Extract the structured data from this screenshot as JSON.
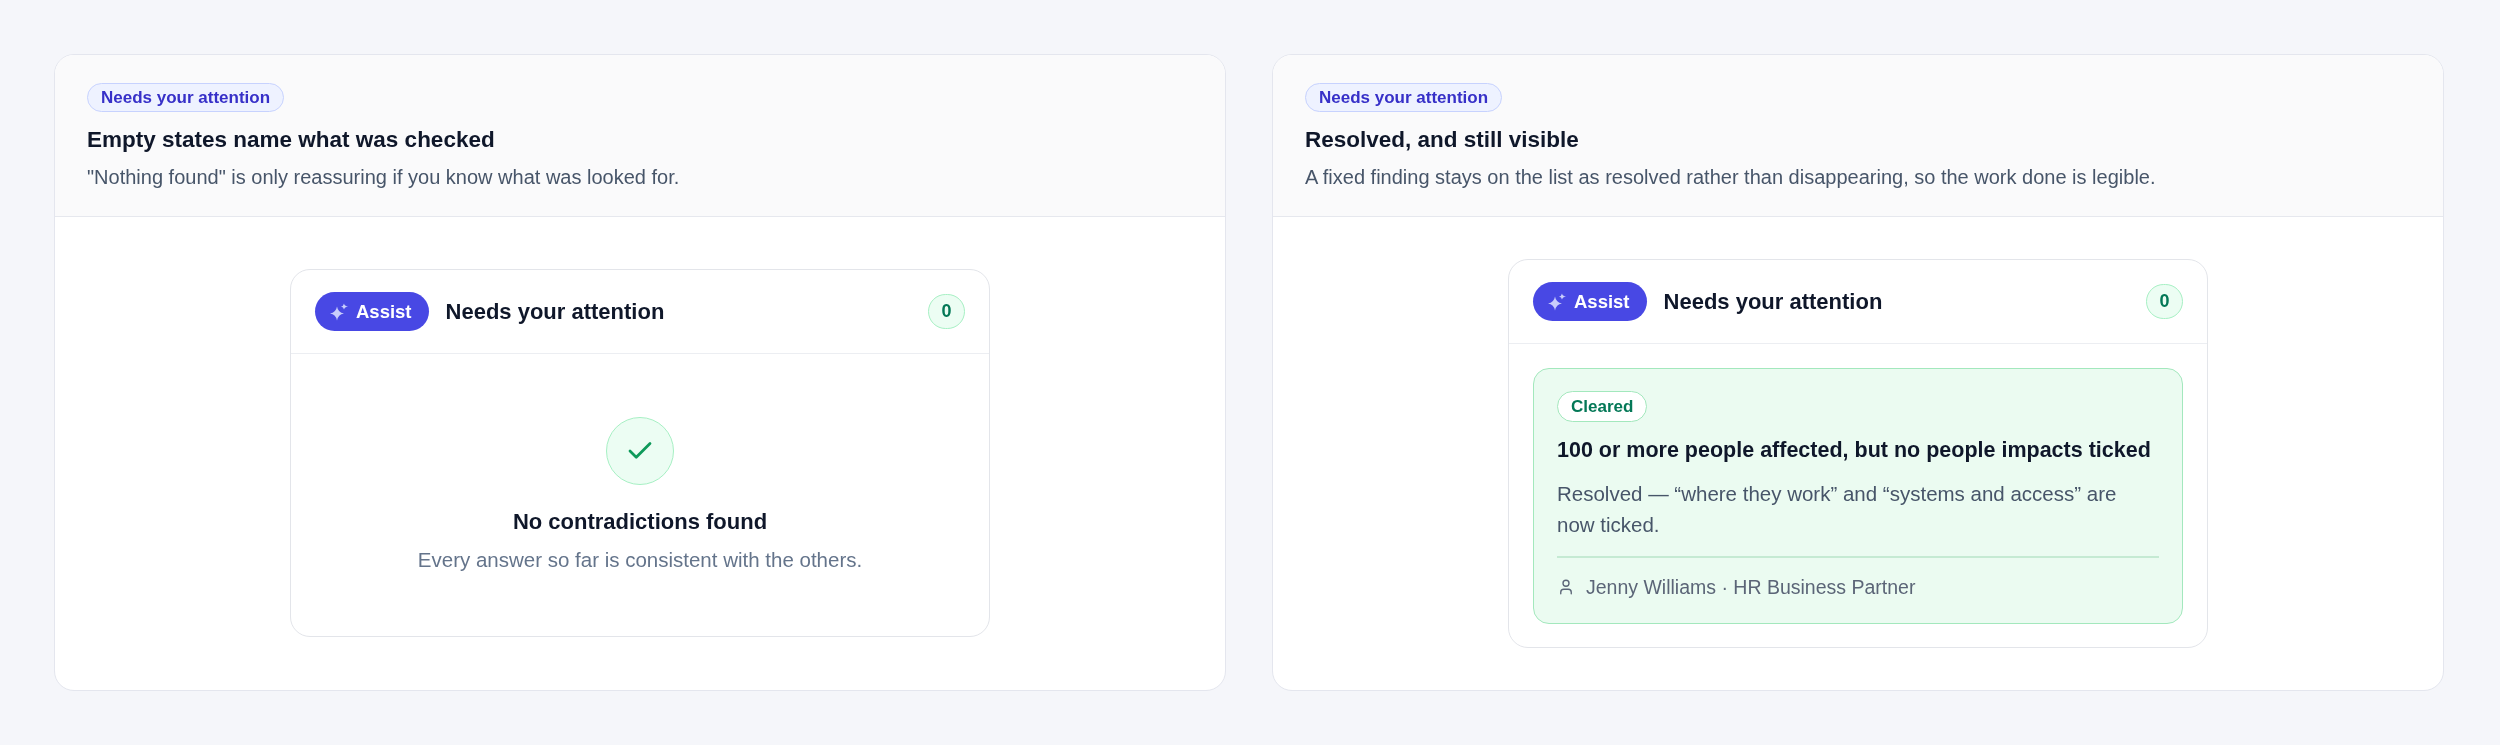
{
  "panels": [
    {
      "badge": "Needs your attention",
      "title": "Empty states name what was checked",
      "description": "\"Nothing found\" is only reassuring if you know what was looked for.",
      "widget": {
        "assist_label": "Assist",
        "title": "Needs your attention",
        "count": "0",
        "content": {
          "kind": "empty",
          "title": "No contradictions found",
          "text": "Every answer so far is consistent with the others."
        }
      }
    },
    {
      "badge": "Needs your attention",
      "title": "Resolved, and still visible",
      "description": "A fixed finding stays on the list as resolved rather than disappearing, so the work done is legible.",
      "widget": {
        "assist_label": "Assist",
        "title": "Needs your attention",
        "count": "0",
        "content": {
          "kind": "findings",
          "findings": [
            {
              "status": "Cleared",
              "resolved": true,
              "title": "100 or more people affected, but no people impacts ticked",
              "text": "Resolved — “where they work” and “systems and access” are now ticked.",
              "author": "Jenny Williams · HR Business Partner"
            }
          ]
        }
      }
    }
  ]
}
